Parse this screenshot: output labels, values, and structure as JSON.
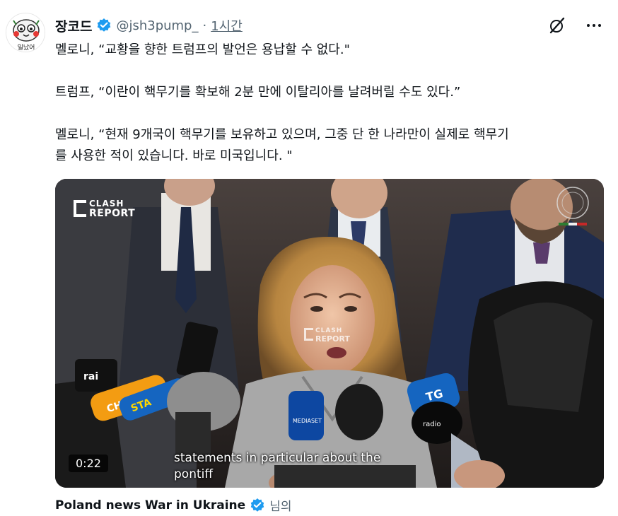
{
  "author": {
    "display_name": "장코드",
    "handle": "@jsh3pump_",
    "separator": "·",
    "time": "1시간",
    "avatar_text": "일났어",
    "verified_icon": "verified-badge-icon"
  },
  "tweet": {
    "lines": [
      "멜로니, “교황을 향한 트럼프의 발언은 용납할 수 없다.\"",
      "트럼프, “이란이 핵무기를 확보해 2분 만에 이탈리아를 날려버릴 수도 있다.”",
      "멜로니, “현재 9개국이 핵무기를 보유하고 있으며, 그중 단 한 나라만이 실제로 핵무기",
      "를 사용한 적이 있습니다. 바로 미국입니다. \""
    ]
  },
  "media": {
    "duration": "0:22",
    "caption_line1": "statements in particular about the",
    "caption_line2": "pontiff",
    "watermark_line1": "CLASH",
    "watermark_line2": "REPORT",
    "mic_labels": [
      "rai",
      "CHIARA",
      "STA",
      "MEDIASET",
      "TG",
      "radio"
    ]
  },
  "attribution": {
    "name": "Poland news War in Ukraine",
    "suffix": "님의"
  },
  "colors": {
    "verified_blue": "#1d9bf0",
    "muted_text": "#536471",
    "text": "#0f1419"
  },
  "icons": [
    "grok-icon",
    "more-icon"
  ]
}
